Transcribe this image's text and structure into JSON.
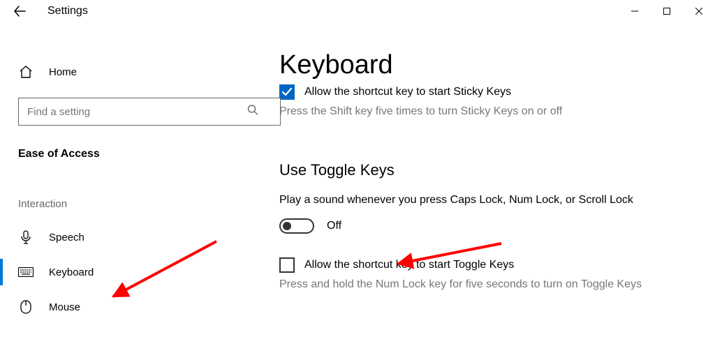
{
  "titlebar": {
    "title": "Settings"
  },
  "sidebar": {
    "home_label": "Home",
    "search_placeholder": "Find a setting",
    "section_label": "Ease of Access",
    "group_label": "Interaction",
    "items": [
      {
        "label": "Speech"
      },
      {
        "label": "Keyboard"
      },
      {
        "label": "Mouse"
      }
    ]
  },
  "main": {
    "page_title": "Keyboard",
    "sticky": {
      "checkbox_label": "Allow the shortcut key to start Sticky Keys",
      "help": "Press the Shift key five times to turn Sticky Keys on or off"
    },
    "toggle_keys": {
      "heading": "Use Toggle Keys",
      "label": "Play a sound whenever you press Caps Lock, Num Lock, or Scroll Lock",
      "state": "Off",
      "checkbox_label": "Allow the shortcut key to start Toggle Keys",
      "help": "Press and hold the Num Lock key for five seconds to turn on Toggle Keys"
    }
  }
}
